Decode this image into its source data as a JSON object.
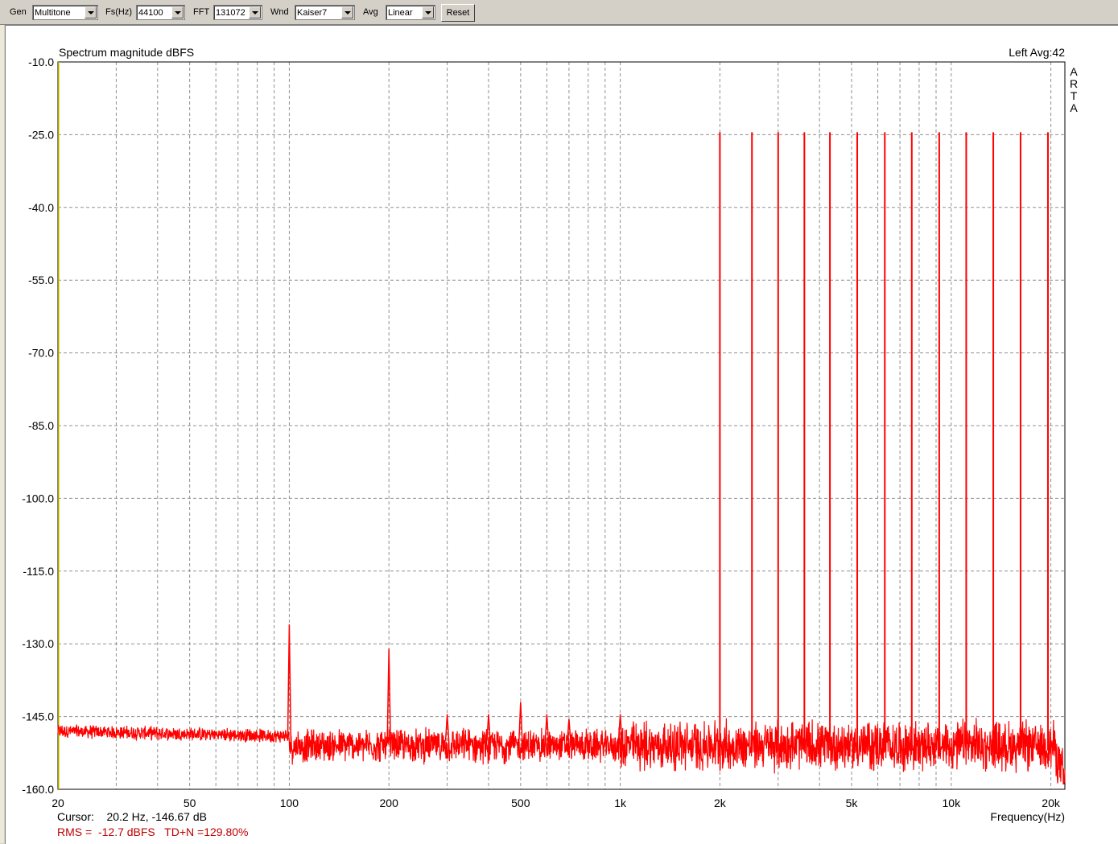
{
  "toolbar": {
    "gen_label": "Gen",
    "gen_value": "Multitone",
    "fs_label": "Fs(Hz)",
    "fs_value": "44100",
    "fft_label": "FFT",
    "fft_value": "131072",
    "wnd_label": "Wnd",
    "wnd_value": "Kaiser7",
    "avg_label": "Avg",
    "avg_value": "Linear",
    "reset_label": "Reset"
  },
  "chart_data": {
    "type": "line",
    "title": "Spectrum magnitude dBFS",
    "channel_label": "Left  Avg:42",
    "brand": [
      "A",
      "R",
      "T",
      "A"
    ],
    "xlabel": "Frequency(Hz)",
    "ylabel": "",
    "x_scale": "log",
    "xlim": [
      20,
      22050
    ],
    "ylim": [
      -160,
      -10
    ],
    "y_ticks": [
      "-10.0",
      "-25.0",
      "-40.0",
      "-55.0",
      "-70.0",
      "-85.0",
      "-100.0",
      "-115.0",
      "-130.0",
      "-145.0",
      "-160.0"
    ],
    "x_ticks": [
      {
        "value": 20,
        "label": "20"
      },
      {
        "value": 50,
        "label": "50"
      },
      {
        "value": 100,
        "label": "100"
      },
      {
        "value": 200,
        "label": "200"
      },
      {
        "value": 500,
        "label": "500"
      },
      {
        "value": 1000,
        "label": "1k"
      },
      {
        "value": 2000,
        "label": "2k"
      },
      {
        "value": 5000,
        "label": "5k"
      },
      {
        "value": 10000,
        "label": "10k"
      },
      {
        "value": 20000,
        "label": "20k"
      }
    ],
    "grid": true,
    "color": "#ff0000",
    "noise_floor_db": -151,
    "tones": [
      {
        "freq": 2000,
        "db": -24.5
      },
      {
        "freq": 2500,
        "db": -24.5
      },
      {
        "freq": 3000,
        "db": -24.5
      },
      {
        "freq": 3600,
        "db": -24.5
      },
      {
        "freq": 4300,
        "db": -24.5
      },
      {
        "freq": 5200,
        "db": -24.5
      },
      {
        "freq": 6300,
        "db": -24.5
      },
      {
        "freq": 7600,
        "db": -24.5
      },
      {
        "freq": 9200,
        "db": -24.5
      },
      {
        "freq": 11100,
        "db": -24.5
      },
      {
        "freq": 13400,
        "db": -24.5
      },
      {
        "freq": 16200,
        "db": -24.5
      },
      {
        "freq": 19600,
        "db": -24.5
      }
    ],
    "spurs": [
      {
        "freq": 100,
        "db": -126
      },
      {
        "freq": 200,
        "db": -131
      },
      {
        "freq": 300,
        "db": -144.5
      },
      {
        "freq": 400,
        "db": -144.5
      },
      {
        "freq": 500,
        "db": -142
      },
      {
        "freq": 600,
        "db": -144.5
      },
      {
        "freq": 700,
        "db": -145.5
      },
      {
        "freq": 1000,
        "db": -144.5
      }
    ],
    "cursor_text": "Cursor:    20.2 Hz, -146.67 dB",
    "rms_text": "RMS =  -12.7 dBFS   TD+N =129.80%"
  }
}
